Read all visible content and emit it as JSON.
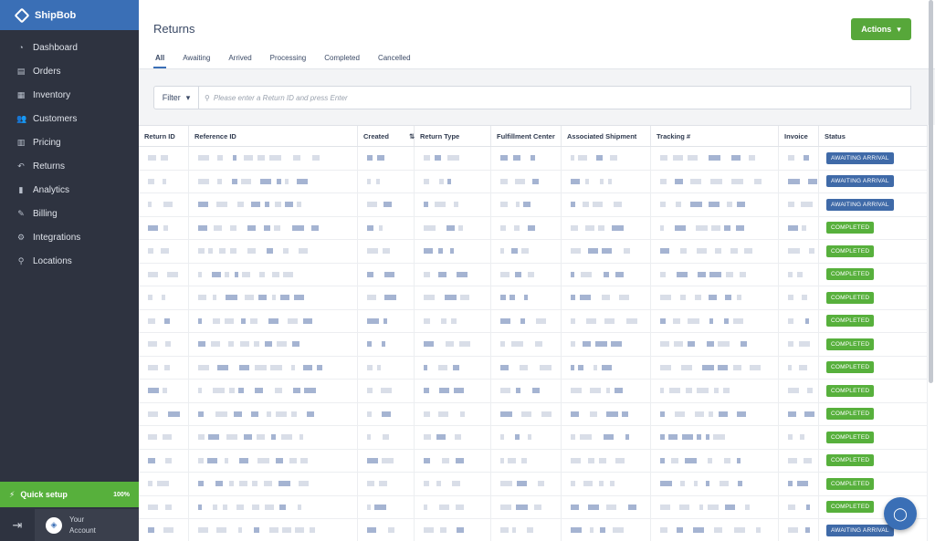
{
  "brand": {
    "name": "ShipBob"
  },
  "sidebar": {
    "items": [
      {
        "label": "Dashboard",
        "icon": "dashboard-icon",
        "glyph": "◔"
      },
      {
        "label": "Orders",
        "icon": "orders-icon",
        "glyph": "▤"
      },
      {
        "label": "Inventory",
        "icon": "inventory-icon",
        "glyph": "▦"
      },
      {
        "label": "Customers",
        "icon": "customers-icon",
        "glyph": "👥"
      },
      {
        "label": "Pricing",
        "icon": "pricing-icon",
        "glyph": "▥"
      },
      {
        "label": "Returns",
        "icon": "returns-icon",
        "glyph": "↶"
      },
      {
        "label": "Analytics",
        "icon": "analytics-icon",
        "glyph": "▮"
      },
      {
        "label": "Billing",
        "icon": "billing-icon",
        "glyph": "✎"
      },
      {
        "label": "Integrations",
        "icon": "integrations-icon",
        "glyph": "⚙"
      },
      {
        "label": "Locations",
        "icon": "locations-icon",
        "glyph": "⚲"
      }
    ],
    "quick_setup": {
      "label": "Quick setup",
      "percent": "100%"
    },
    "account": {
      "line1": "Your",
      "line2": "Account"
    }
  },
  "header": {
    "title": "Returns",
    "actions_label": "Actions",
    "tabs": [
      "All",
      "Awaiting",
      "Arrived",
      "Processing",
      "Completed",
      "Cancelled"
    ]
  },
  "filter": {
    "label": "Filter",
    "placeholder": "Please enter a Return ID and press Enter"
  },
  "table": {
    "columns": [
      "Return ID",
      "Reference ID",
      "Created",
      "Return Type",
      "Fulfillment Center",
      "Associated Shipment",
      "Tracking #",
      "Invoice",
      "Status"
    ],
    "statuses": [
      "AWAITING ARRIVAL",
      "AWAITING ARRIVAL",
      "AWAITING ARRIVAL",
      "COMPLETED",
      "COMPLETED",
      "COMPLETED",
      "COMPLETED",
      "COMPLETED",
      "COMPLETED",
      "COMPLETED",
      "COMPLETED",
      "COMPLETED",
      "COMPLETED",
      "COMPLETED",
      "COMPLETED",
      "COMPLETED",
      "AWAITING ARRIVAL"
    ]
  },
  "colors": {
    "sidebar": "#2e3340",
    "brand": "#3a6fb6",
    "accent_green": "#57b03c",
    "awaiting_badge": "#3f6aa8"
  }
}
